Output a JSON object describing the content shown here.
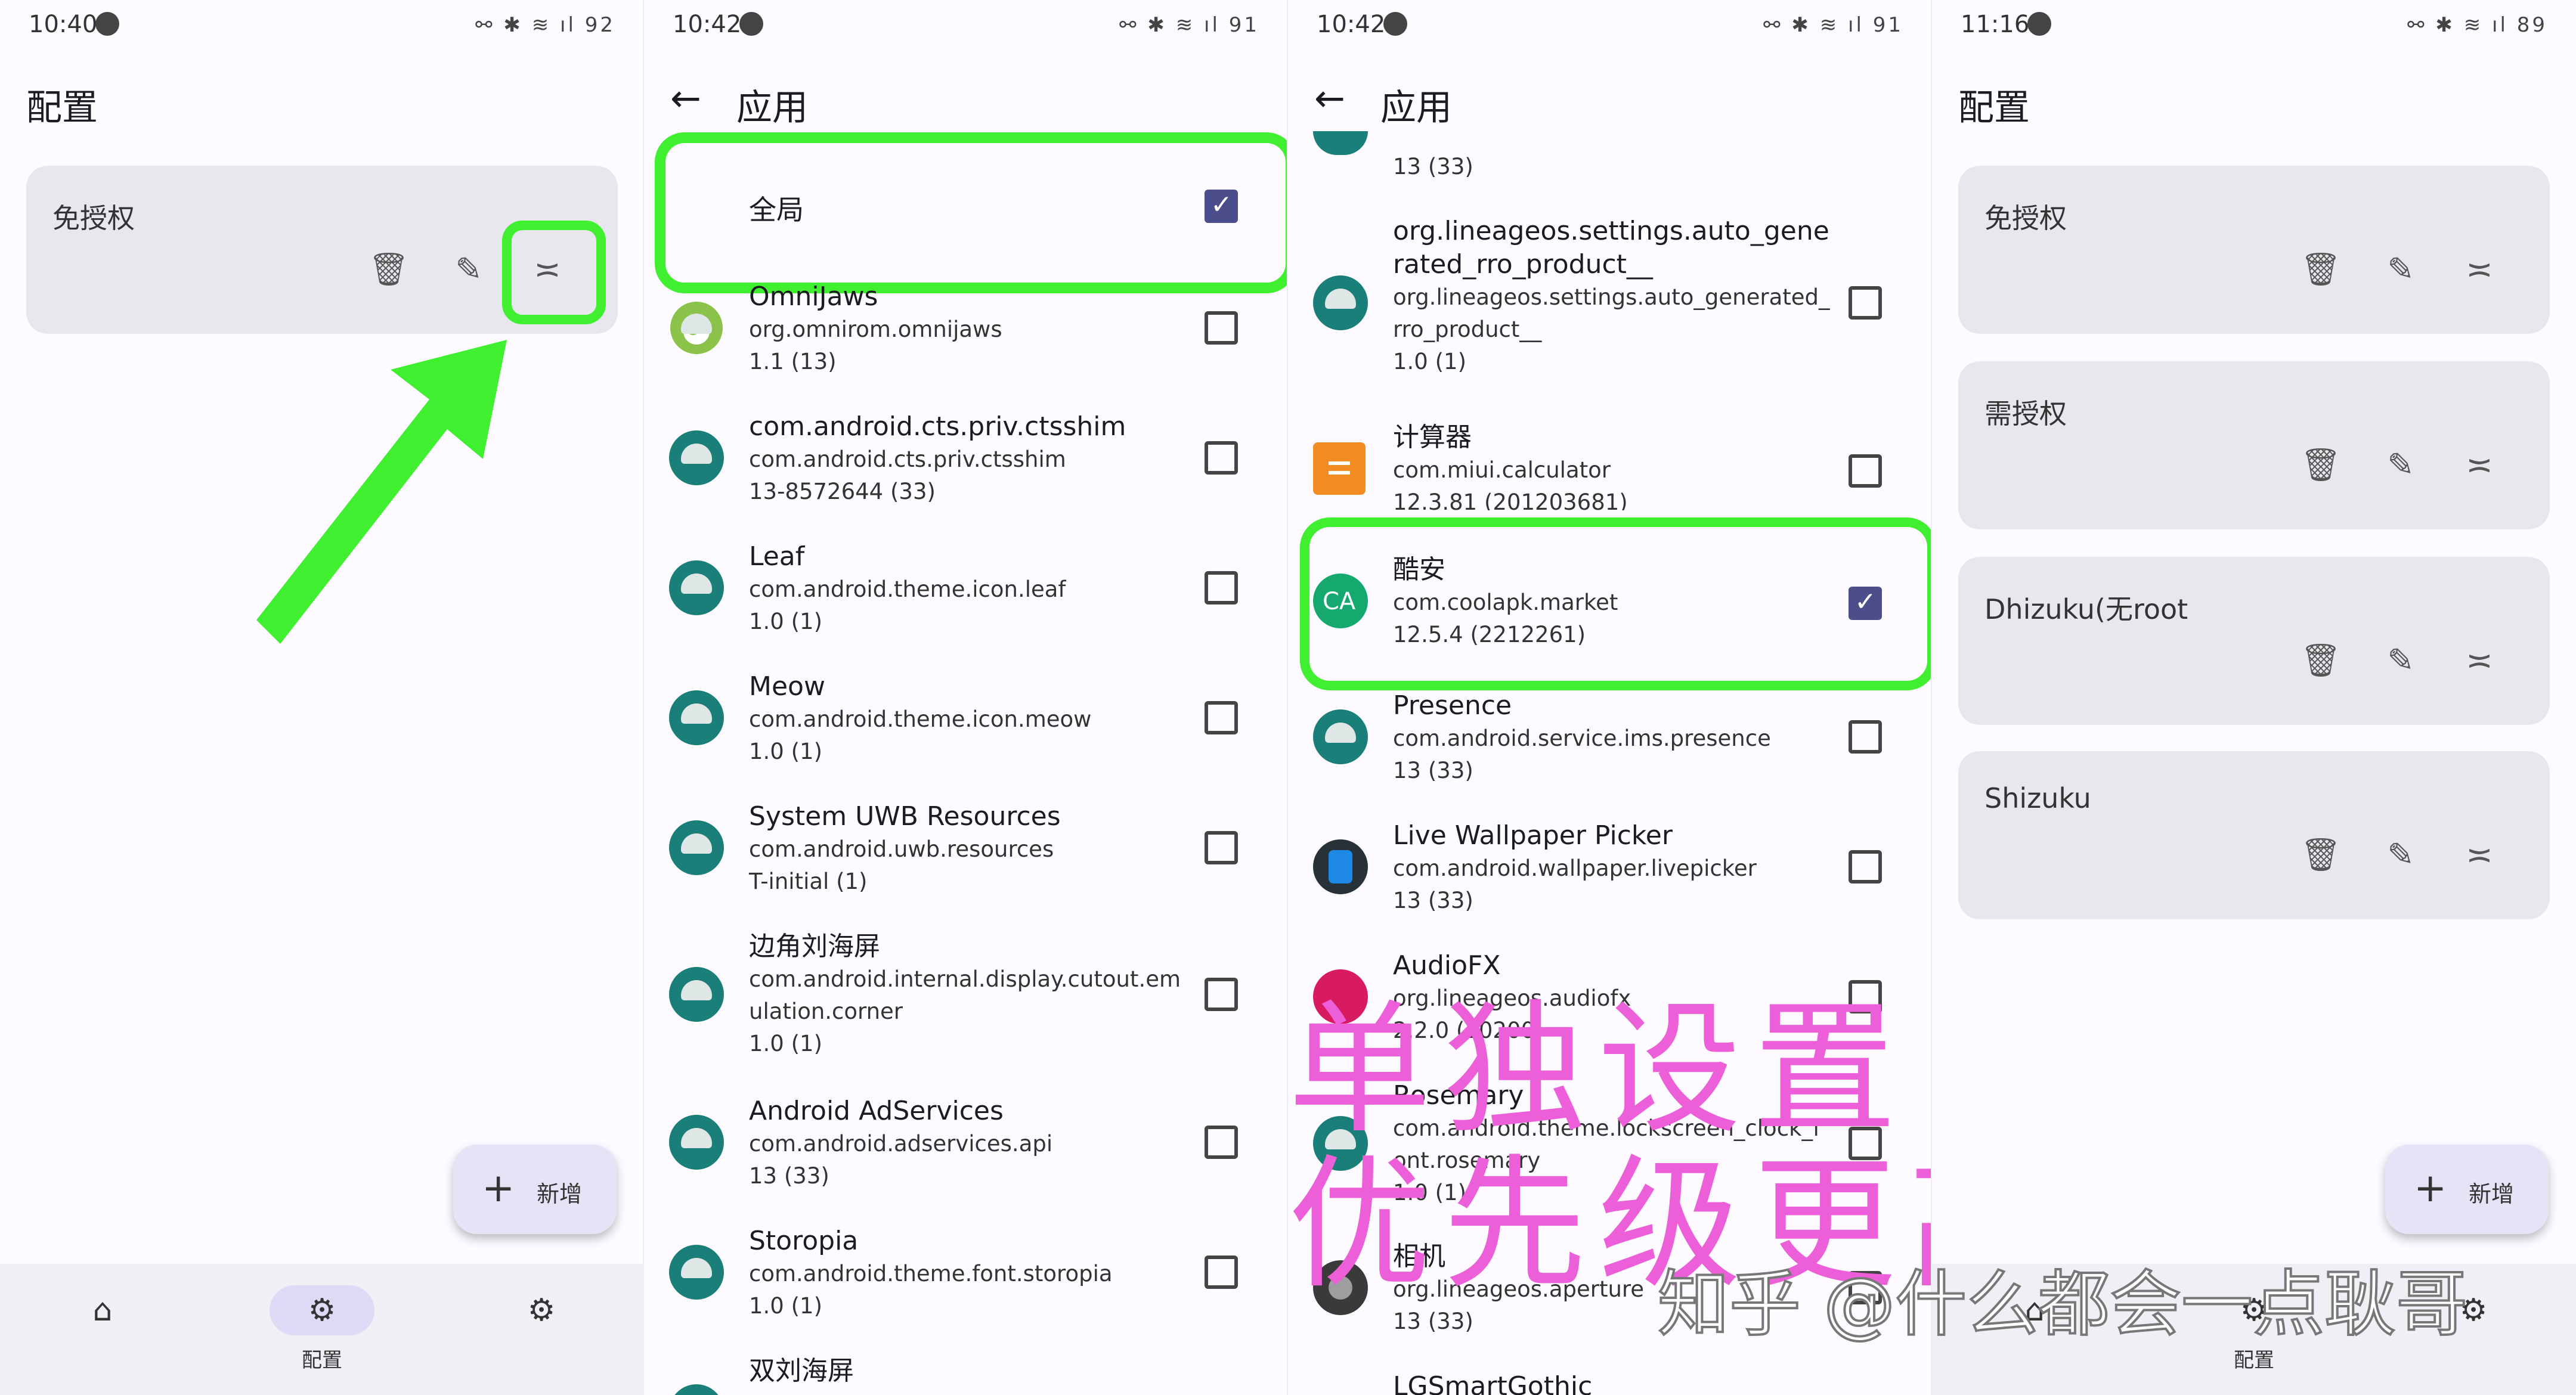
{
  "panel1": {
    "status_time": "10:40",
    "status_battery": "92",
    "title": "配置",
    "cards": [
      {
        "name": "免授权"
      }
    ],
    "fab_label": "新增",
    "nav": [
      {
        "label": ""
      },
      {
        "label": "配置"
      },
      {
        "label": ""
      }
    ]
  },
  "panel2": {
    "status_time": "10:42",
    "status_battery": "91",
    "back_icon": "arrow-left-icon",
    "title": "应用",
    "global_label": "全局",
    "rows": [
      {
        "name": "OmniJaws",
        "pkg": "org.omnirom.omnijaws",
        "ver": "1.1 (13)",
        "checked": false
      },
      {
        "name": "com.android.cts.priv.ctsshim",
        "pkg": "com.android.cts.priv.ctsshim",
        "ver": "13-8572644 (33)",
        "checked": false
      },
      {
        "name": "Leaf",
        "pkg": "com.android.theme.icon.leaf",
        "ver": "1.0 (1)",
        "checked": false
      },
      {
        "name": "Meow",
        "pkg": "com.android.theme.icon.meow",
        "ver": "1.0 (1)",
        "checked": false
      },
      {
        "name": "System UWB Resources",
        "pkg": "com.android.uwb.resources",
        "ver": "T-initial (1)",
        "checked": false
      },
      {
        "name": "边角刘海屏",
        "pkg": "com.android.internal.display.cutout.em",
        "pkg2": "ulation.corner",
        "ver": "1.0 (1)",
        "checked": false
      },
      {
        "name": "Android AdServices",
        "pkg": "com.android.adservices.api",
        "ver": "13 (33)",
        "checked": false
      },
      {
        "name": "Storopia",
        "pkg": "com.android.theme.font.storopia",
        "ver": "1.0 (1)",
        "checked": false
      },
      {
        "name": "双刘海屏",
        "pkg": "",
        "ver": "",
        "checked": false
      }
    ]
  },
  "panel3": {
    "status_time": "10:42",
    "status_battery": "91",
    "title": "应用",
    "top_ver": "13 (33)",
    "rows": [
      {
        "name": "org.lineageos.settings.auto_gene",
        "name2": "rated_rro_product__",
        "pkg": "org.lineageos.settings.auto_generated_",
        "pkg2": "rro_product__",
        "ver": "1.0 (1)",
        "checked": false
      },
      {
        "name": "计算器",
        "pkg": "com.miui.calculator",
        "ver": "12.3.81 (201203681)",
        "checked": false
      },
      {
        "name": "酷安",
        "pkg": "com.coolapk.market",
        "ver": "12.5.4 (2212261)",
        "checked": true
      },
      {
        "name": "Presence",
        "pkg": "com.android.service.ims.presence",
        "ver": "13 (33)",
        "checked": false
      },
      {
        "name": "Live Wallpaper Picker",
        "pkg": "com.android.wallpaper.livepicker",
        "ver": "13 (33)",
        "checked": false
      },
      {
        "name": "AudioFX",
        "pkg": "org.lineageos.audiofx",
        "ver": "2.2.0 (20200",
        "checked": false
      },
      {
        "name": "Rosemary",
        "pkg": "com.android.theme.lockscreen_clock_f",
        "pkg2": "ont.rosemary",
        "ver": "1.0 (1)",
        "checked": false
      },
      {
        "name": "相机",
        "pkg": "org.lineageos.aperture",
        "ver": "13 (33)",
        "checked": false
      },
      {
        "name": "LGSmartGothic",
        "pkg": "",
        "ver": "",
        "checked": false
      }
    ],
    "overlay_line1": "单独设置",
    "overlay_line2": "优先级更高"
  },
  "panel4": {
    "status_time": "11:16",
    "status_battery": "89",
    "title": "配置",
    "cards": [
      {
        "name": "免授权"
      },
      {
        "name": "需授权"
      },
      {
        "name": "Dhizuku(无root"
      },
      {
        "name": "Shizuku"
      }
    ],
    "fab_label": "新增",
    "nav": [
      {
        "label": ""
      },
      {
        "label": "配置"
      },
      {
        "label": ""
      }
    ]
  },
  "watermark": "知乎 @什么都会一点耿哥",
  "colors": {
    "highlight": "#40f030",
    "overlay_text": "#ec5fd8",
    "checkbox_checked": "#4b4e8a",
    "card_bg": "#e8e7ee",
    "android_icon": "#1a7f79"
  }
}
